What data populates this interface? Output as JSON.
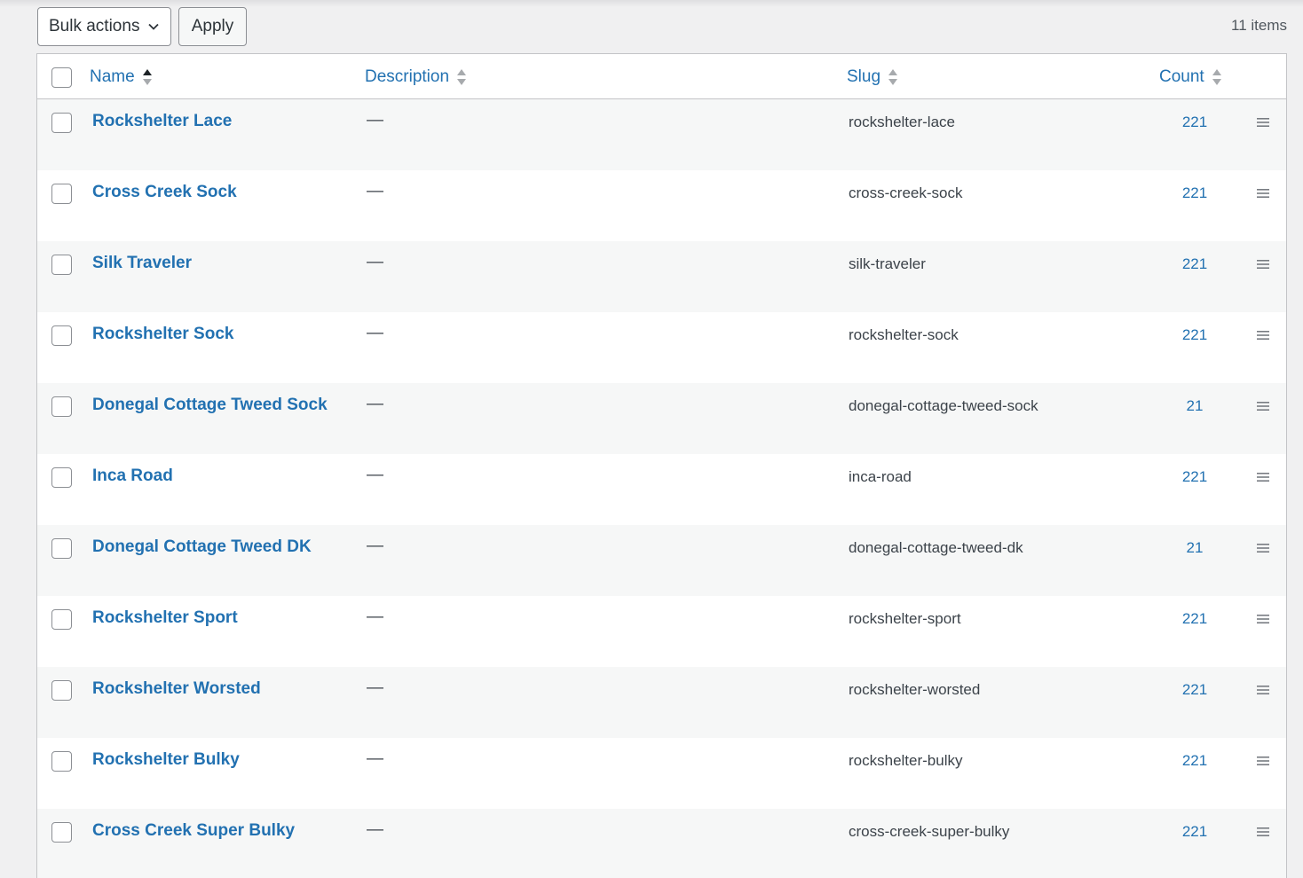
{
  "toolbar": {
    "bulk_actions_label": "Bulk actions",
    "apply_label": "Apply",
    "items_count": "11 items"
  },
  "columns": {
    "name": "Name",
    "description": "Description",
    "slug": "Slug",
    "count": "Count"
  },
  "colors": {
    "link": "#2271b1",
    "row_alt": "#f6f7f7",
    "border": "#c3c4c7"
  },
  "rows": [
    {
      "name": "Rockshelter Lace",
      "description": "—",
      "slug": "rockshelter-lace",
      "count": "221"
    },
    {
      "name": "Cross Creek Sock",
      "description": "—",
      "slug": "cross-creek-sock",
      "count": "221"
    },
    {
      "name": "Silk Traveler",
      "description": "—",
      "slug": "silk-traveler",
      "count": "221"
    },
    {
      "name": "Rockshelter Sock",
      "description": "—",
      "slug": "rockshelter-sock",
      "count": "221"
    },
    {
      "name": "Donegal Cottage Tweed Sock",
      "description": "—",
      "slug": "donegal-cottage-tweed-sock",
      "count": "21"
    },
    {
      "name": "Inca Road",
      "description": "—",
      "slug": "inca-road",
      "count": "221"
    },
    {
      "name": "Donegal Cottage Tweed DK",
      "description": "—",
      "slug": "donegal-cottage-tweed-dk",
      "count": "21"
    },
    {
      "name": "Rockshelter Sport",
      "description": "—",
      "slug": "rockshelter-sport",
      "count": "221"
    },
    {
      "name": "Rockshelter Worsted",
      "description": "—",
      "slug": "rockshelter-worsted",
      "count": "221"
    },
    {
      "name": "Rockshelter Bulky",
      "description": "—",
      "slug": "rockshelter-bulky",
      "count": "221"
    },
    {
      "name": "Cross Creek Super Bulky",
      "description": "—",
      "slug": "cross-creek-super-bulky",
      "count": "221"
    }
  ]
}
